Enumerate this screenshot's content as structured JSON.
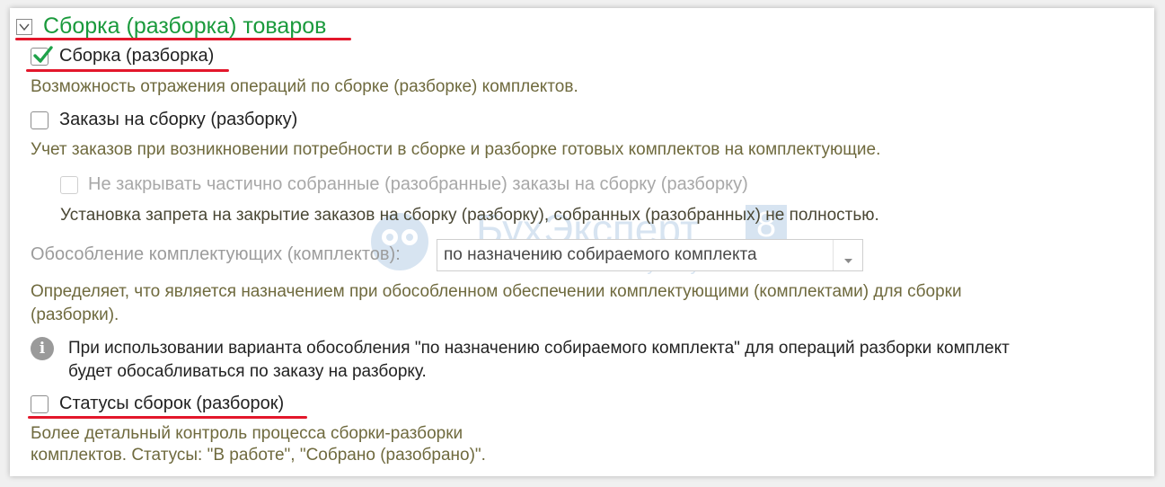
{
  "section": {
    "title": "Сборка (разборка) товаров",
    "expanded": true
  },
  "assembly": {
    "label": "Сборка (разборка)",
    "checked": true,
    "description": "Возможность отражения операций по сборке (разборке) комплектов."
  },
  "orders": {
    "label": "Заказы на сборку (разборку)",
    "checked": false,
    "description": "Учет заказов при возникновении потребности в сборке и разборке готовых комплектов на комплектующие."
  },
  "no_close": {
    "label": "Не закрывать частично собранные (разобранные) заказы на сборку (разборку)",
    "checked": false,
    "enabled": false,
    "description": "Установка запрета на закрытие заказов на сборку (разборку), собранных (разобранных) не полностью."
  },
  "separation": {
    "label": "Обособление комплектующих (комплектов):",
    "value": "по назначению собираемого комплекта",
    "description_line1": "Определяет, что является назначением при обособленном обеспечении комплектующими (комплектами) для сборки",
    "description_line2": "(разборки)."
  },
  "info": {
    "line1": "При использовании варианта обособления \"по назначению собираемого комплекта\" для операций разборки комплект",
    "line2": "будет обосабливаться по заказу на разборку."
  },
  "statuses": {
    "label": "Статусы сборок (разборок)",
    "checked": false,
    "description_line1": "Более детальный контроль процесса сборки-разборки",
    "description_line2": "комплектов. Статусы: \"В работе\", \"Собрано (разобрано)\"."
  },
  "watermark": {
    "brand": "БухЭксперт",
    "digit": "8",
    "tagline": "База ответов по учету в 1С"
  },
  "colors": {
    "title_green": "#1a9a3c",
    "description_olive": "#6f6a3e",
    "check_green": "#1fa24a",
    "highlight_red": "#e3172b"
  }
}
